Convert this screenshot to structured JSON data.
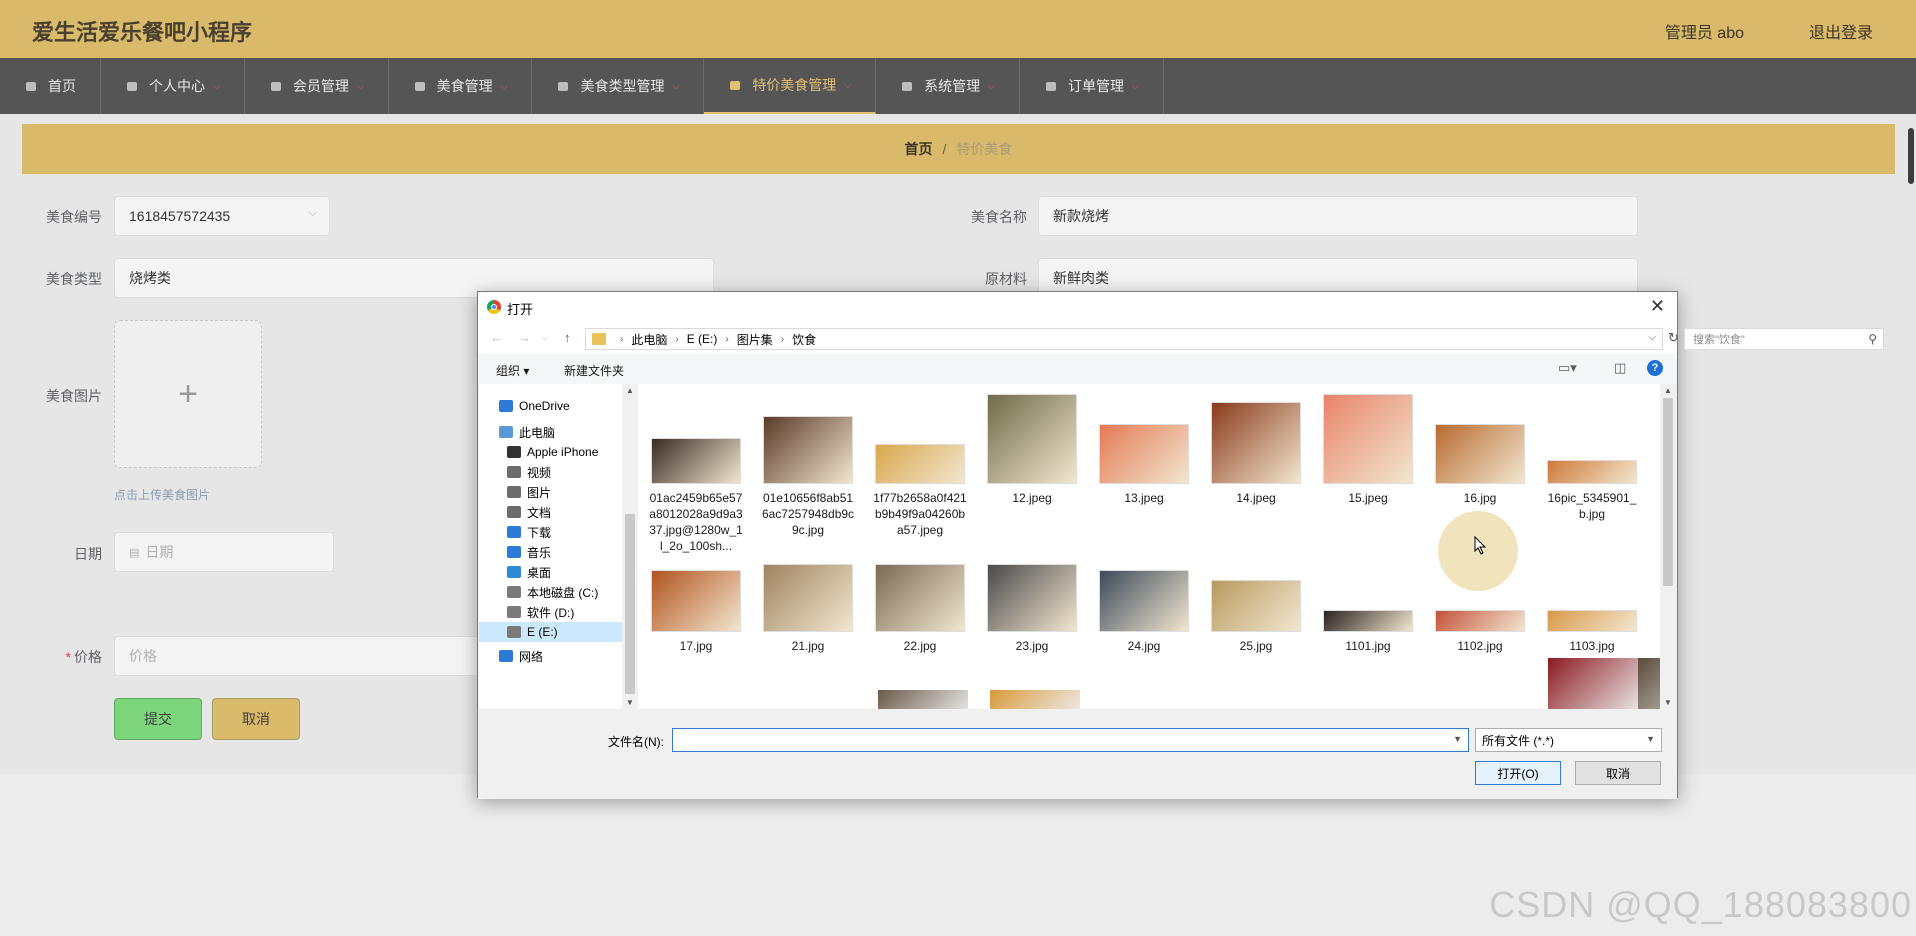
{
  "header": {
    "title": "爱生活爱乐餐吧小程序",
    "admin": "管理员 abo",
    "logout": "退出登录"
  },
  "nav": [
    {
      "label": "首页",
      "icon": "home-icon",
      "caret": false
    },
    {
      "label": "个人中心",
      "icon": "user-icon",
      "caret": true
    },
    {
      "label": "会员管理",
      "icon": "sliders-icon",
      "caret": true
    },
    {
      "label": "美食管理",
      "icon": "compass-icon",
      "caret": true
    },
    {
      "label": "美食类型管理",
      "icon": "globe-icon",
      "caret": true
    },
    {
      "label": "特价美食管理",
      "icon": "briefcase-icon",
      "caret": true,
      "active": true
    },
    {
      "label": "系统管理",
      "icon": "ticket-icon",
      "caret": true
    },
    {
      "label": "订单管理",
      "icon": "person-icon",
      "caret": true
    }
  ],
  "breadcrumb": {
    "home": "首页",
    "sep": "/",
    "current": "特价美食"
  },
  "form": {
    "code_label": "美食编号",
    "code_value": "1618457572435",
    "name_label": "美食名称",
    "name_value": "新款烧烤",
    "type_label": "美食类型",
    "type_value": "烧烤类",
    "material_label": "原材料",
    "material_value": "新鲜肉类",
    "image_label": "美食图片",
    "upload_tip": "点击上传美食图片",
    "date_label": "日期",
    "date_placeholder": "日期",
    "price_label": "价格",
    "price_required": "*",
    "price_placeholder": "价格",
    "submit": "提交",
    "cancel": "取消"
  },
  "watermark": "CSDN @QQ_188083800",
  "dialog": {
    "title": "打开",
    "path": [
      "此电脑",
      "E (E:)",
      "图片集",
      "饮食"
    ],
    "search_placeholder": "搜索\"饮食\"",
    "organize": "组织 ▾",
    "new_folder": "新建文件夹",
    "tree": [
      {
        "label": "OneDrive",
        "icon": "cloud-icon",
        "indent": 1
      },
      {
        "label": "此电脑",
        "icon": "computer-icon",
        "indent": 1
      },
      {
        "label": "Apple iPhone",
        "icon": "phone-icon",
        "indent": 2
      },
      {
        "label": "视频",
        "icon": "video-icon",
        "indent": 2
      },
      {
        "label": "图片",
        "icon": "picture-icon",
        "indent": 2
      },
      {
        "label": "文档",
        "icon": "document-icon",
        "indent": 2
      },
      {
        "label": "下载",
        "icon": "download-icon",
        "indent": 2
      },
      {
        "label": "音乐",
        "icon": "music-icon",
        "indent": 2
      },
      {
        "label": "桌面",
        "icon": "desktop-icon",
        "indent": 2
      },
      {
        "label": "本地磁盘 (C:)",
        "icon": "drive-icon",
        "indent": 2
      },
      {
        "label": "软件 (D:)",
        "icon": "drive-icon",
        "indent": 2
      },
      {
        "label": "E (E:)",
        "icon": "drive-icon",
        "indent": 2,
        "selected": true
      },
      {
        "label": "网络",
        "icon": "network-icon",
        "indent": 1
      }
    ],
    "files": [
      {
        "name": "01ac2459b65e57a8012028a9d9a337.jpg@1280w_1l_2o_100sh...",
        "color": "#3a2a25"
      },
      {
        "name": "01e10656f8ab516ac7257948db9c9c.jpg",
        "color": "#5a3a28"
      },
      {
        "name": "1f77b2658a0f421b9b49f9a04260ba57.jpeg",
        "color": "#d9a84c"
      },
      {
        "name": "12.jpeg",
        "color": "#6f6b4a"
      },
      {
        "name": "13.jpeg",
        "color": "#e47a55"
      },
      {
        "name": "14.jpeg",
        "color": "#8a3a1c"
      },
      {
        "name": "15.jpeg",
        "color": "#e8846a"
      },
      {
        "name": "16.jpg",
        "color": "#b86a30"
      },
      {
        "name": "16pic_5345901_b.jpg",
        "color": "#cf7a3a"
      },
      {
        "name": "17.jpg",
        "color": "#b2541f"
      },
      {
        "name": "21.jpg",
        "color": "#9e8460"
      },
      {
        "name": "22.jpg",
        "color": "#7a6a55"
      },
      {
        "name": "23.jpg",
        "color": "#4a4a4c"
      },
      {
        "name": "24.jpg",
        "color": "#3c4a5a"
      },
      {
        "name": "25.jpg",
        "color": "#b89a60"
      },
      {
        "name": "1101.jpg",
        "color": "#2a2320"
      },
      {
        "name": "1102.jpg",
        "color": "#c4523a"
      },
      {
        "name": "1103.jpg",
        "color": "#d9994a"
      }
    ],
    "filename_label": "文件名(N):",
    "filetype": "所有文件 (*.*)",
    "open": "打开(O)",
    "cancel": "取消"
  }
}
